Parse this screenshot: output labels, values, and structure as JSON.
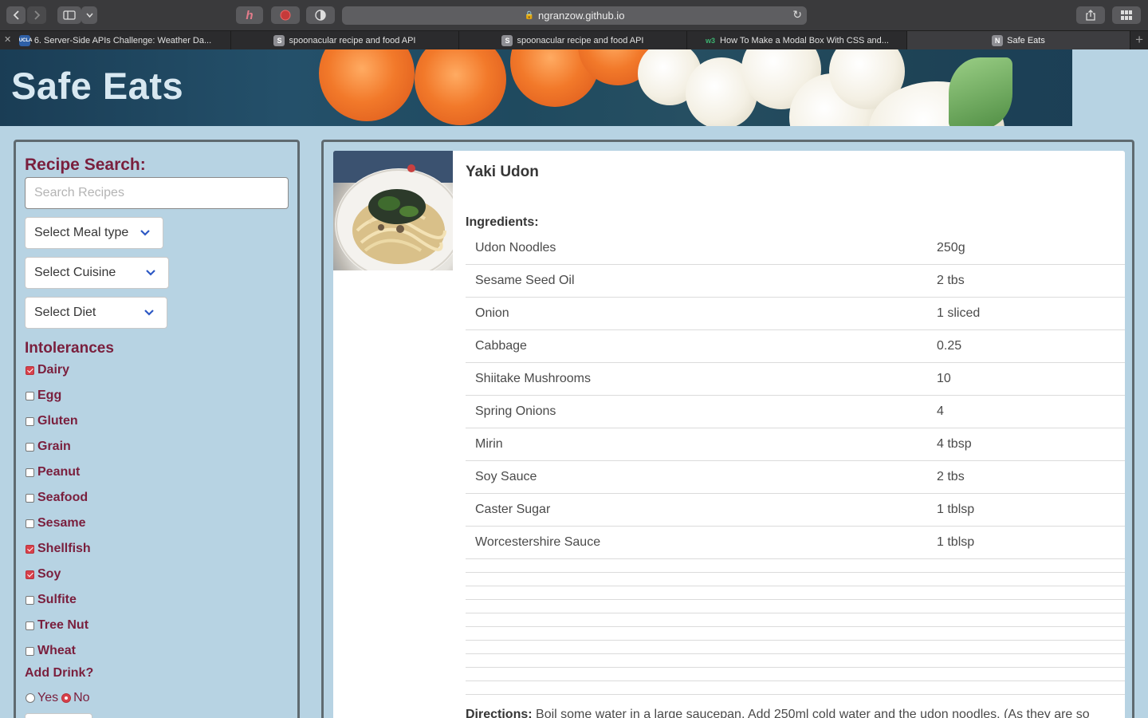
{
  "browser": {
    "url": "ngranzow.github.io",
    "tabs": [
      {
        "label": "6. Server-Side APIs Challenge: Weather Da...",
        "favicon": "UCLA",
        "active": false
      },
      {
        "label": "spoonacular recipe and food API",
        "favicon": "S",
        "active": false
      },
      {
        "label": "spoonacular recipe and food API",
        "favicon": "S",
        "active": false
      },
      {
        "label": "How To Make a Modal Box With CSS and...",
        "favicon": "w3",
        "active": false
      },
      {
        "label": "Safe Eats",
        "favicon": "N",
        "active": true
      }
    ]
  },
  "header": {
    "title": "Safe Eats"
  },
  "sidebar": {
    "heading": "Recipe Search:",
    "search_placeholder": "Search Recipes",
    "meal_type": "Select Meal type",
    "cuisine": "Select Cuisine",
    "diet": "Select Diet",
    "intolerances_heading": "Intolerances",
    "intolerances": [
      {
        "label": "Dairy",
        "checked": true
      },
      {
        "label": "Egg",
        "checked": false
      },
      {
        "label": "Gluten",
        "checked": false
      },
      {
        "label": "Grain",
        "checked": false
      },
      {
        "label": "Peanut",
        "checked": false
      },
      {
        "label": "Seafood",
        "checked": false
      },
      {
        "label": "Sesame",
        "checked": false
      },
      {
        "label": "Shellfish",
        "checked": true
      },
      {
        "label": "Soy",
        "checked": true
      },
      {
        "label": "Sulfite",
        "checked": false
      },
      {
        "label": "Tree Nut",
        "checked": false
      },
      {
        "label": "Wheat",
        "checked": false
      }
    ],
    "drink_heading": "Add Drink?",
    "drink_yes": "Yes",
    "drink_no": "No",
    "drink_selected": "No"
  },
  "recipe": {
    "title": "Yaki Udon",
    "ingredients_heading": "Ingredients:",
    "ingredients": [
      {
        "name": "Udon Noodles",
        "amount": "250g"
      },
      {
        "name": "Sesame Seed Oil",
        "amount": "2 tbs"
      },
      {
        "name": "Onion",
        "amount": "1 sliced"
      },
      {
        "name": "Cabbage",
        "amount": "0.25"
      },
      {
        "name": "Shiitake Mushrooms",
        "amount": "10"
      },
      {
        "name": "Spring Onions",
        "amount": "4"
      },
      {
        "name": "Mirin",
        "amount": "4 tbsp"
      },
      {
        "name": "Soy Sauce",
        "amount": "2 tbs"
      },
      {
        "name": "Caster Sugar",
        "amount": "1 tblsp"
      },
      {
        "name": "Worcestershire Sauce",
        "amount": "1 tblsp"
      }
    ],
    "directions_label": "Directions:",
    "directions_text": "Boil some water in a large saucepan. Add 250ml cold water and the udon noodles. (As they are so"
  }
}
